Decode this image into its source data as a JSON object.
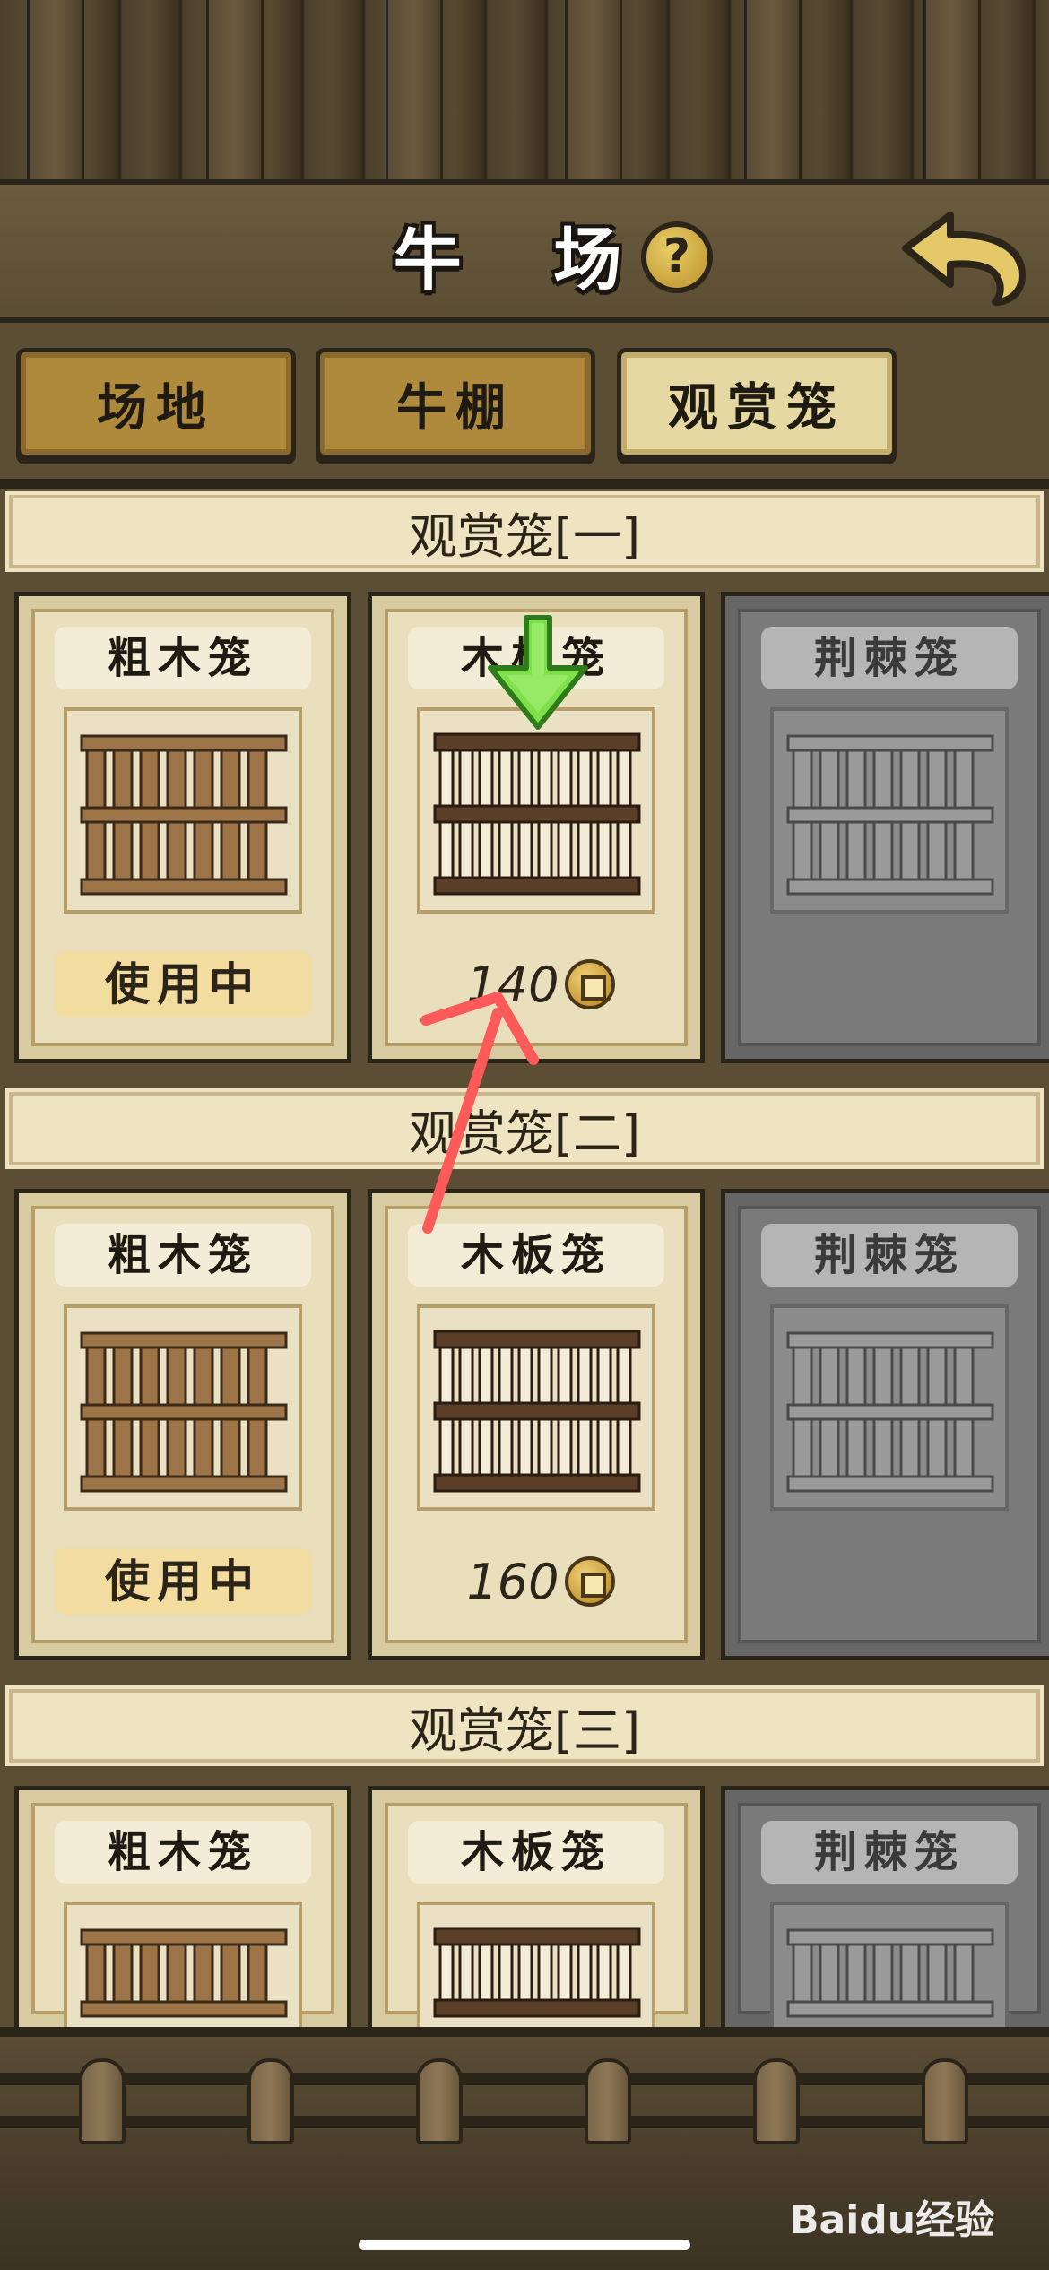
{
  "header": {
    "title": "牛 场"
  },
  "tabs": [
    {
      "label": "场地",
      "active": false
    },
    {
      "label": "牛棚",
      "active": false
    },
    {
      "label": "观赏笼",
      "active": true
    }
  ],
  "sections": [
    {
      "title": "观赏笼[一]",
      "cards": [
        {
          "name": "粗木笼",
          "status": "使用中"
        },
        {
          "name": "木板笼",
          "price": "140"
        },
        {
          "name": "荆棘笼",
          "locked": true
        }
      ]
    },
    {
      "title": "观赏笼[二]",
      "cards": [
        {
          "name": "粗木笼",
          "status": "使用中"
        },
        {
          "name": "木板笼",
          "price": "160"
        },
        {
          "name": "荆棘笼",
          "locked": true
        }
      ]
    },
    {
      "title": "观赏笼[三]",
      "cards": [
        {
          "name": "粗木笼"
        },
        {
          "name": "木板笼"
        },
        {
          "name": "荆棘笼",
          "locked": true
        }
      ]
    }
  ],
  "watermark": "Baidu经验",
  "colors": {
    "accent": "#e6d8a2",
    "annotation": "#ff5a5a",
    "upgrade": "#6fd63a"
  }
}
